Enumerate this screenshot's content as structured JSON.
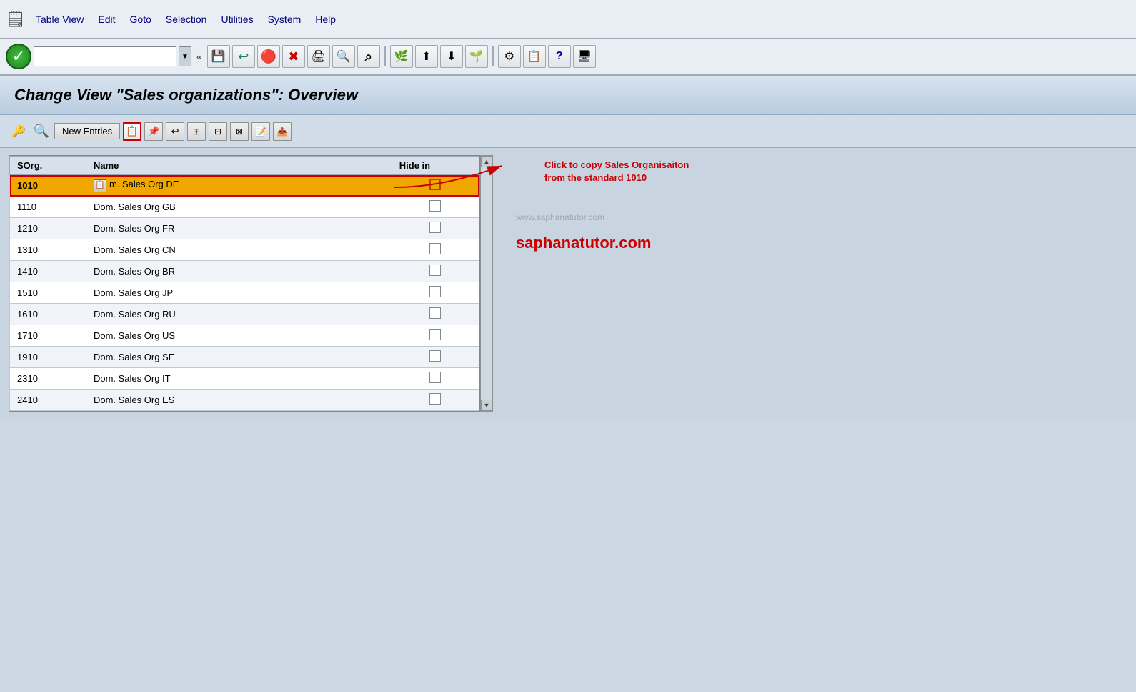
{
  "menubar": {
    "items": [
      {
        "label": "Table View",
        "id": "table-view"
      },
      {
        "label": "Edit",
        "id": "edit"
      },
      {
        "label": "Goto",
        "id": "goto"
      },
      {
        "label": "Selection",
        "id": "selection"
      },
      {
        "label": "Utilities",
        "id": "utilities"
      },
      {
        "label": "System",
        "id": "system"
      },
      {
        "label": "Help",
        "id": "help"
      }
    ]
  },
  "toolbar": {
    "dropdown_value": "",
    "double_arrow": "«"
  },
  "page": {
    "title": "Change View \"Sales organizations\": Overview"
  },
  "content_toolbar": {
    "new_entries_label": "New Entries"
  },
  "table": {
    "columns": [
      {
        "label": "SOrg.",
        "id": "sorg"
      },
      {
        "label": "Name",
        "id": "name"
      },
      {
        "label": "Hide in",
        "id": "hide_in"
      }
    ],
    "rows": [
      {
        "sorg": "1010",
        "name": "m. Sales Org DE",
        "hide_in": false,
        "highlighted": true
      },
      {
        "sorg": "1110",
        "name": "Dom. Sales Org GB",
        "hide_in": false,
        "highlighted": false
      },
      {
        "sorg": "1210",
        "name": "Dom. Sales Org FR",
        "hide_in": false,
        "highlighted": false
      },
      {
        "sorg": "1310",
        "name": "Dom. Sales Org CN",
        "hide_in": false,
        "highlighted": false
      },
      {
        "sorg": "1410",
        "name": "Dom. Sales Org BR",
        "hide_in": false,
        "highlighted": false
      },
      {
        "sorg": "1510",
        "name": "Dom. Sales Org JP",
        "hide_in": false,
        "highlighted": false
      },
      {
        "sorg": "1610",
        "name": "Dom. Sales Org RU",
        "hide_in": false,
        "highlighted": false
      },
      {
        "sorg": "1710",
        "name": "Dom. Sales Org US",
        "hide_in": false,
        "highlighted": false
      },
      {
        "sorg": "1910",
        "name": "Dom. Sales Org SE",
        "hide_in": false,
        "highlighted": false
      },
      {
        "sorg": "2310",
        "name": "Dom. Sales Org IT",
        "hide_in": false,
        "highlighted": false
      },
      {
        "sorg": "2410",
        "name": "Dom. Sales Org ES",
        "hide_in": false,
        "highlighted": false
      }
    ]
  },
  "annotation": {
    "arrow_text": "Click to copy Sales Organisaiton\nfrom the standard 1010"
  },
  "watermark": "www.saphanatutor.com",
  "brand": "saphanatutor.com"
}
